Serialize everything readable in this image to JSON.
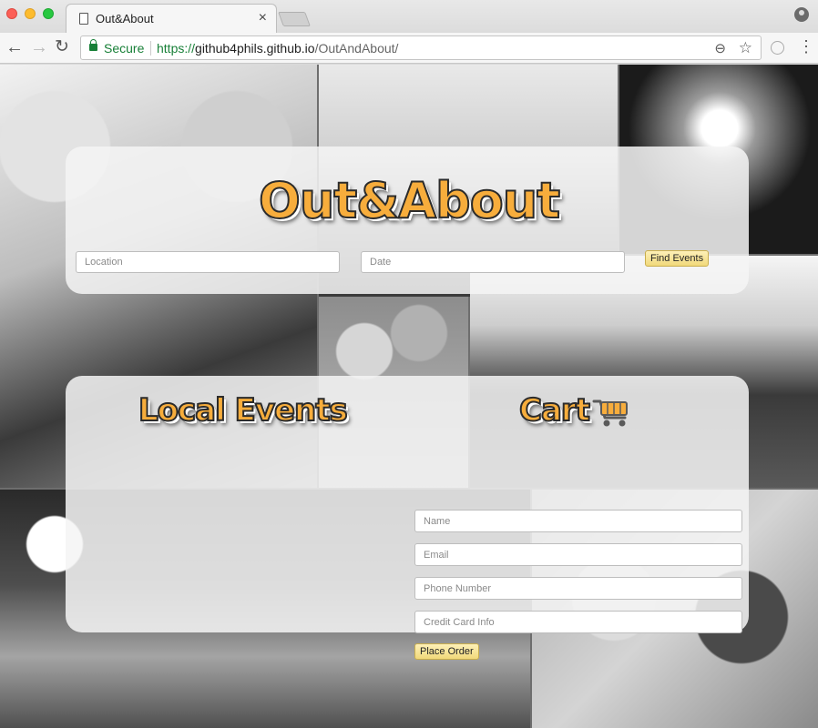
{
  "browser": {
    "tab_title": "Out&About",
    "tab_close": "×",
    "secure_label": "Secure",
    "url_scheme": "https://",
    "url_host": "github4phils.github.io",
    "url_path": "/OutAndAbout/",
    "icons": [
      "page-icon",
      "close-icon",
      "back-icon",
      "forward-icon",
      "reload-icon",
      "lock-icon",
      "zoom-icon",
      "star-icon",
      "extension-icon",
      "menu-icon",
      "profile-icon"
    ]
  },
  "hero": {
    "logo": "Out&About",
    "location_placeholder": "Location",
    "date_placeholder": "Date",
    "find_button": "Find Events"
  },
  "content": {
    "local_events_title": "Local Events",
    "cart_title": "Cart",
    "cart_icon": "shopping-cart-icon",
    "name_placeholder": "Name",
    "email_placeholder": "Email",
    "phone_placeholder": "Phone Number",
    "card_placeholder": "Credit Card Info",
    "order_button": "Place Order"
  },
  "colors": {
    "logo_fill": "#f7ad3c",
    "button_fill": "#f1d97a",
    "secure_green": "#188038"
  }
}
